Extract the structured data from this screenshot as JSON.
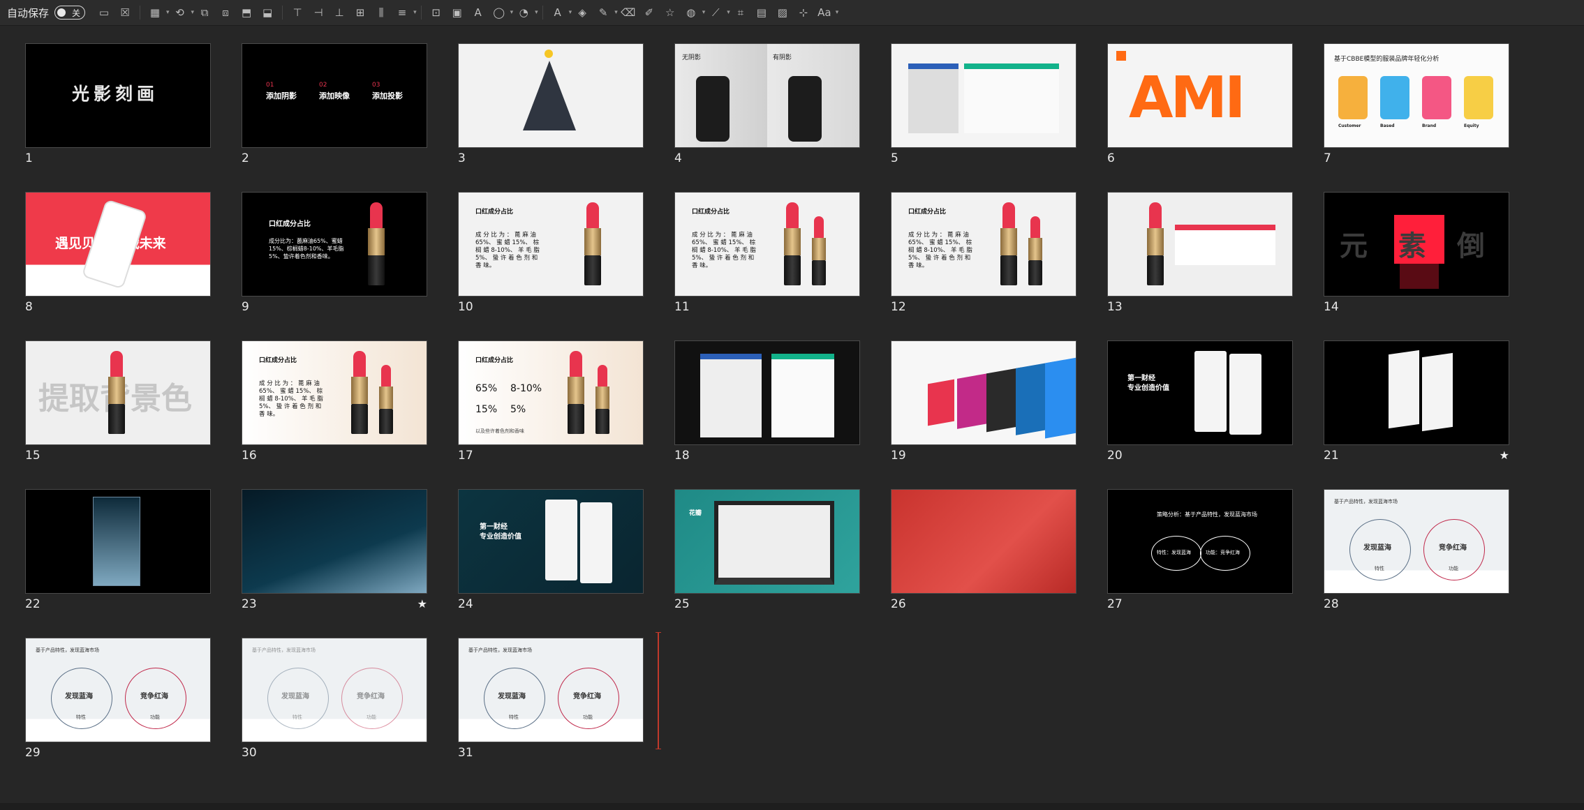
{
  "toolbar": {
    "autosave_label": "自动保存",
    "autosave_state": "关",
    "icons": [
      "slide-icon",
      "blank-icon",
      "layout-icon",
      "reset-icon",
      "arrange-icon",
      "group-icon",
      "bring-forward-icon",
      "send-backward-icon",
      "align-top-icon",
      "align-right-icon",
      "align-bottom-icon",
      "align-center-icon",
      "distribute-icon",
      "align-middle-icon",
      "crop-icon",
      "picture-icon",
      "textbox-icon",
      "shape-icon",
      "shape-fill-icon",
      "font-color-icon",
      "highlight-icon",
      "pen-icon",
      "eraser-icon",
      "format-painter-icon",
      "star-icon",
      "merge-shapes-icon",
      "line-icon",
      "crop-tool-icon",
      "ruler-icon",
      "selection-pane-icon",
      "size-icon",
      "font-size-icon"
    ]
  },
  "slides": [
    {
      "number": "1",
      "star": false,
      "title": "光影刻画"
    },
    {
      "number": "2",
      "star": false,
      "items": [
        {
          "num": "01",
          "label": "添加阴影"
        },
        {
          "num": "02",
          "label": "添加映像"
        },
        {
          "num": "03",
          "label": "添加投影"
        }
      ]
    },
    {
      "number": "3",
      "star": false
    },
    {
      "number": "4",
      "star": false,
      "labels": [
        "无阴影",
        "有阴影"
      ]
    },
    {
      "number": "5",
      "star": false
    },
    {
      "number": "6",
      "star": false,
      "text": "AMI"
    },
    {
      "number": "7",
      "star": false,
      "title": "基于CBBE模型的服装品牌年轻化分析",
      "captions": [
        "Customer",
        "Based",
        "Brand",
        "Equity"
      ]
    },
    {
      "number": "8",
      "star": false,
      "title": "遇见贝合 赢战未来"
    },
    {
      "number": "9",
      "star": false,
      "heading": "口红成分占比",
      "body": "成分比为：蓖麻油65%、蜜蜡15%、棕榈蜡8-10%、羊毛脂5%、蛰许着色剂和香味。"
    },
    {
      "number": "10",
      "star": false,
      "heading": "口红成分占比",
      "body": "成 分 比 为 ： 蓖 麻 油 65%、 蜜 蜡 15%、 棕 榈 蜡 8-10%、 羊 毛 脂 5%、 蛰 许 着 色 剂 和 香 味。"
    },
    {
      "number": "11",
      "star": false,
      "heading": "口红成分占比",
      "body": "成 分 比 为 ： 蓖 麻 油 65%、 蜜 蜡 15%、 棕 榈 蜡 8-10%、 羊 毛 脂 5%、 蛰 许 着 色 剂 和 香 味。"
    },
    {
      "number": "12",
      "star": false,
      "heading": "口红成分占比",
      "body": "成 分 比 为 ： 蓖 麻 油 65%、 蜜 蜡 15%、 棕 榈 蜡 8-10%、 羊 毛 脂 5%、 蛰 许 着 色 剂 和 香 味。"
    },
    {
      "number": "13",
      "star": false
    },
    {
      "number": "14",
      "star": false,
      "text": "元素倒影"
    },
    {
      "number": "15",
      "star": false,
      "text": "提取背景色"
    },
    {
      "number": "16",
      "star": false,
      "heading": "口红成分占比",
      "body": "成 分 比 为 ： 蓖 麻 油 65%、 蜜 蜡 15%、 棕 榈 蜡 8-10%、 羊 毛 脂 5%、 蛰 许 着 色 剂 和 香 味。"
    },
    {
      "number": "17",
      "star": false,
      "heading": "口红成分占比",
      "stats": [
        "65%",
        "8-10%",
        "15%",
        "5%"
      ],
      "footer": "以及些许着色剂和香味"
    },
    {
      "number": "18",
      "star": false
    },
    {
      "number": "19",
      "star": false
    },
    {
      "number": "20",
      "star": false,
      "text": "第一财经 专业创造价值"
    },
    {
      "number": "21",
      "star": true
    },
    {
      "number": "22",
      "star": false
    },
    {
      "number": "23",
      "star": true
    },
    {
      "number": "24",
      "star": false,
      "text": "第一财经 专业创造价值"
    },
    {
      "number": "25",
      "star": false,
      "text": "花瓣"
    },
    {
      "number": "26",
      "star": false
    },
    {
      "number": "27",
      "star": false,
      "title": "策略分析：基于产品特性，发现蓝海市场",
      "left": "特性：发现蓝海",
      "right": "功能：竞争红海"
    },
    {
      "number": "28",
      "star": false,
      "title": "基于产品特性，发现蓝海市场",
      "left": "发现蓝海",
      "right": "竞争红海",
      "left_sub": "特性",
      "right_sub": "功能"
    },
    {
      "number": "29",
      "star": false,
      "title": "基于产品特性，发现蓝海市场",
      "left": "发现蓝海",
      "right": "竞争红海",
      "left_sub": "特性",
      "right_sub": "功能"
    },
    {
      "number": "30",
      "star": false,
      "title": "基于产品特性，发现蓝海市场",
      "left": "发现蓝海",
      "right": "竞争红海",
      "left_sub": "特性",
      "right_sub": "功能"
    },
    {
      "number": "31",
      "star": false,
      "title": "基于产品特性，发现蓝海市场",
      "left": "发现蓝海",
      "right": "竞争红海",
      "left_sub": "特性",
      "right_sub": "功能"
    }
  ],
  "colors": {
    "background": "#262626",
    "toolbar": "#2c2c2c",
    "accent_red": "#e8344e",
    "orange": "#ff6a13",
    "teal": "#1f8a86"
  }
}
